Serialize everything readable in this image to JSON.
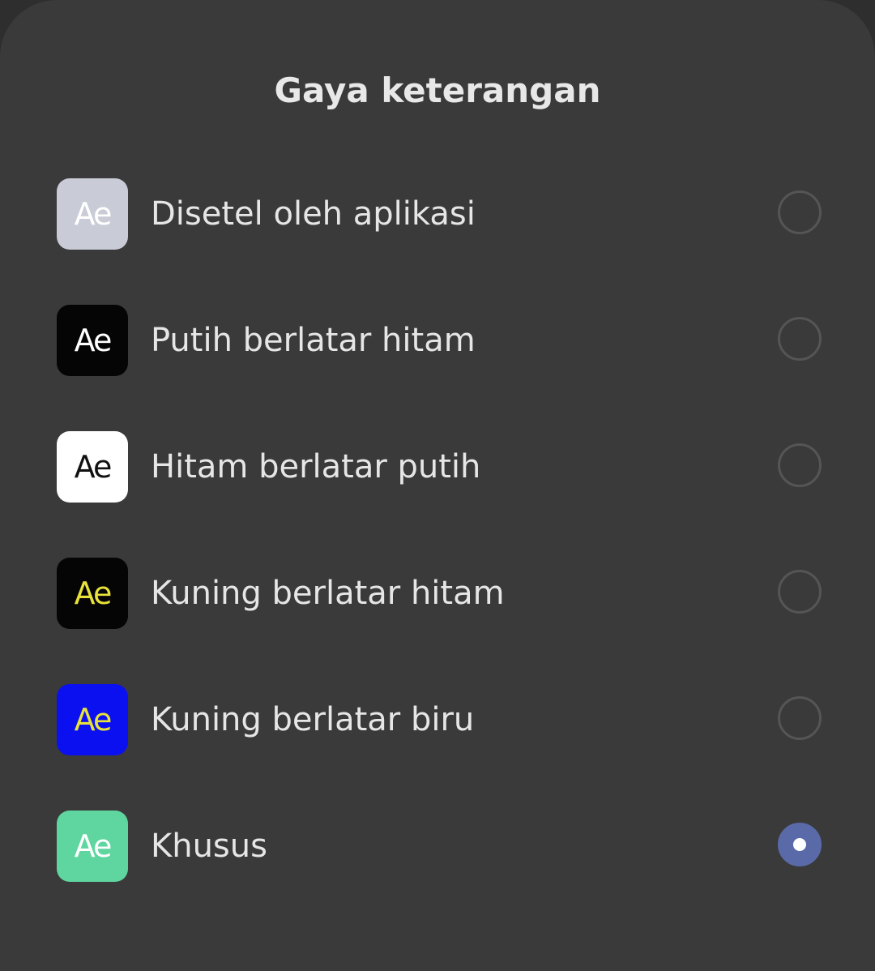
{
  "dialog": {
    "title": "Gaya keterangan"
  },
  "options": [
    {
      "label": "Disetel oleh aplikasi",
      "preview_text": "Ae",
      "swatch_bg": "#c9ccd6",
      "swatch_fg": "#ffffff",
      "selected": false
    },
    {
      "label": "Putih berlatar hitam",
      "preview_text": "Ae",
      "swatch_bg": "#050505",
      "swatch_fg": "#ffffff",
      "selected": false
    },
    {
      "label": "Hitam berlatar putih",
      "preview_text": "Ae",
      "swatch_bg": "#ffffff",
      "swatch_fg": "#111111",
      "selected": false
    },
    {
      "label": "Kuning berlatar hitam",
      "preview_text": "Ae",
      "swatch_bg": "#050505",
      "swatch_fg": "#e8e23a",
      "selected": false
    },
    {
      "label": "Kuning berlatar biru",
      "preview_text": "Ae",
      "swatch_bg": "#0a10f0",
      "swatch_fg": "#e8e23a",
      "selected": false
    },
    {
      "label": "Khusus",
      "preview_text": "Ae",
      "swatch_bg": "#5fd6a0",
      "swatch_fg": "#ffffff",
      "selected": true
    }
  ],
  "colors": {
    "selected_radio": "#5a6aa8",
    "unselected_radio_border": "#555555"
  }
}
